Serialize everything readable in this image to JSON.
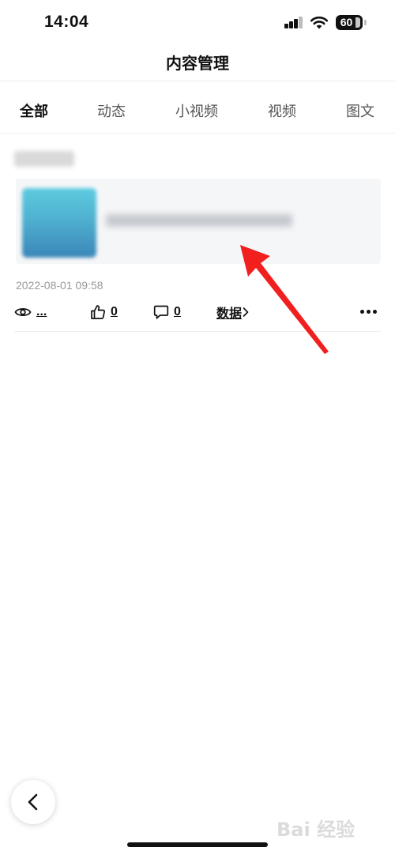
{
  "status_bar": {
    "time": "14:04",
    "battery": "60"
  },
  "nav": {
    "title": "内容管理"
  },
  "tabs": [
    {
      "label": "全部",
      "active": true
    },
    {
      "label": "动态",
      "active": false
    },
    {
      "label": "小视频",
      "active": false
    },
    {
      "label": "视频",
      "active": false
    },
    {
      "label": "图文",
      "active": false
    }
  ],
  "item": {
    "date": "2022-08-01 09:58",
    "views": "...",
    "likes": "0",
    "comments": "0",
    "data_link": "数据"
  },
  "annotation": {
    "arrow_color": "#f21f1f"
  },
  "watermark": {
    "text": "Bai 经验"
  },
  "icons": [
    "signal-icon",
    "wifi-icon",
    "battery-icon",
    "eye-icon",
    "thumbs-up-icon",
    "comment-icon",
    "chevron-right-icon",
    "more-icon",
    "back-icon"
  ]
}
